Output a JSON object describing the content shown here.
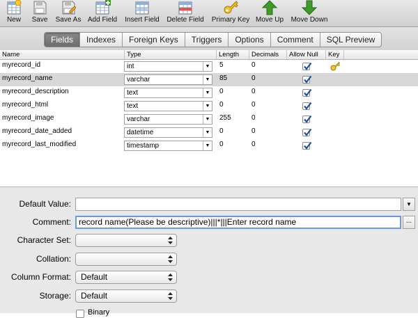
{
  "toolbar": {
    "new": "New",
    "save": "Save",
    "save_as": "Save As",
    "add_field": "Add Field",
    "insert_field": "Insert Field",
    "delete_field": "Delete Field",
    "primary_key": "Primary Key",
    "move_up": "Move Up",
    "move_down": "Move Down"
  },
  "tabs": [
    "Fields",
    "Indexes",
    "Foreign Keys",
    "Triggers",
    "Options",
    "Comment",
    "SQL Preview"
  ],
  "active_tab": "Fields",
  "columns": [
    "Name",
    "Type",
    "Length",
    "Decimals",
    "Allow Null",
    "Key"
  ],
  "fields": [
    {
      "name": "myrecord_id",
      "type": "int",
      "length": "5",
      "decimals": "0",
      "allow_null": true,
      "key": true,
      "selected": false
    },
    {
      "name": "myrecord_name",
      "type": "varchar",
      "length": "85",
      "decimals": "0",
      "allow_null": true,
      "key": false,
      "selected": true
    },
    {
      "name": "myrecord_description",
      "type": "text",
      "length": "0",
      "decimals": "0",
      "allow_null": true,
      "key": false,
      "selected": false
    },
    {
      "name": "myrecord_html",
      "type": "text",
      "length": "0",
      "decimals": "0",
      "allow_null": true,
      "key": false,
      "selected": false
    },
    {
      "name": "myrecord_image",
      "type": "varchar",
      "length": "255",
      "decimals": "0",
      "allow_null": true,
      "key": false,
      "selected": false
    },
    {
      "name": "myrecord_date_added",
      "type": "datetime",
      "length": "0",
      "decimals": "0",
      "allow_null": true,
      "key": false,
      "selected": false
    },
    {
      "name": "myrecord_last_modified",
      "type": "timestamp",
      "length": "0",
      "decimals": "0",
      "allow_null": true,
      "key": false,
      "selected": false
    }
  ],
  "properties": {
    "default_value_label": "Default Value:",
    "default_value": "",
    "comment_label": "Comment:",
    "comment": "record name(Please be descriptive)|||*|||Enter record name",
    "comment_more": "...",
    "character_set_label": "Character Set:",
    "character_set": "",
    "collation_label": "Collation:",
    "collation": "",
    "column_format_label": "Column Format:",
    "column_format": "Default",
    "storage_label": "Storage:",
    "storage": "Default",
    "binary_label": "Binary"
  },
  "colors": {
    "selected_row": "#d8d8d8",
    "focus_ring": "#6d9bd6",
    "arrow_green": "#3f9a2a",
    "checkbox_check": "#1f4f9e"
  }
}
